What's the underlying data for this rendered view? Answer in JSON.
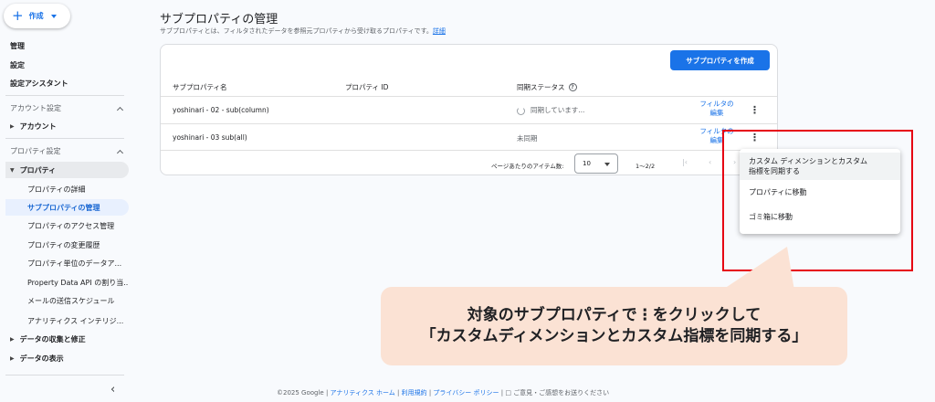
{
  "sidebar": {
    "create_label": "作成",
    "top_items": [
      "管理",
      "設定",
      "設定アシスタント"
    ],
    "account_section": "アカウント設定",
    "account_item": "アカウント",
    "property_section": "プロパティ設定",
    "property_group": "プロパティ",
    "property_items": [
      "プロパティの詳細",
      "サブプロパティの管理",
      "プロパティのアクセス管理",
      "プロパティの変更履歴",
      "プロパティ単位のデータア...",
      "Property Data API の割り当...",
      "メールの送信スケジュール",
      "アナリティクス インテリジ..."
    ],
    "bottom_items": [
      "データの収集と修正",
      "データの表示"
    ],
    "collapse_glyph": "‹"
  },
  "main": {
    "title": "サブプロパティの管理",
    "description": "サブプロパティとは、フィルタされたデータを参照元プロパティから受け取るプロパティです。",
    "description_link": "詳細",
    "create_button": "サブプロパティを作成",
    "columns": [
      "サブプロパティ名",
      "プロパティ ID",
      "同期ステータス"
    ],
    "rows": [
      {
        "name": "yoshinari - 02 - sub(column)",
        "id": "",
        "status": "同期しています...",
        "filter_link_1": "フィルタの",
        "filter_link_2": "編集"
      },
      {
        "name": "yoshinari - 03 sub(all)",
        "id": "",
        "status": "未同期",
        "filter_link_1": "フィルタの",
        "filter_link_2": "編集"
      }
    ],
    "pager": {
      "items_label": "ページあたりのアイテム数:",
      "page_size": "10",
      "range": "1〜2/2"
    }
  },
  "menu": {
    "items": [
      "カスタム ディメンションとカスタム",
      "指標を同期する",
      "プロパティに移動",
      "ゴミ箱に移動"
    ]
  },
  "callout": {
    "line1": "対象のサブプロパティで⋮をクリックして",
    "line2": "「カスタムディメンションとカスタム指標を同期する」"
  },
  "footer": {
    "copyright": "©2025 Google",
    "links": [
      "アナリティクス ホーム",
      "利用規約",
      "プライバシー ポリシー"
    ],
    "feedback": "ご意見・ご感想をお送りください"
  },
  "colors": {
    "accent": "#1a73e8",
    "highlight_box": "#e60012",
    "callout_bg": "#fbe2d4"
  }
}
